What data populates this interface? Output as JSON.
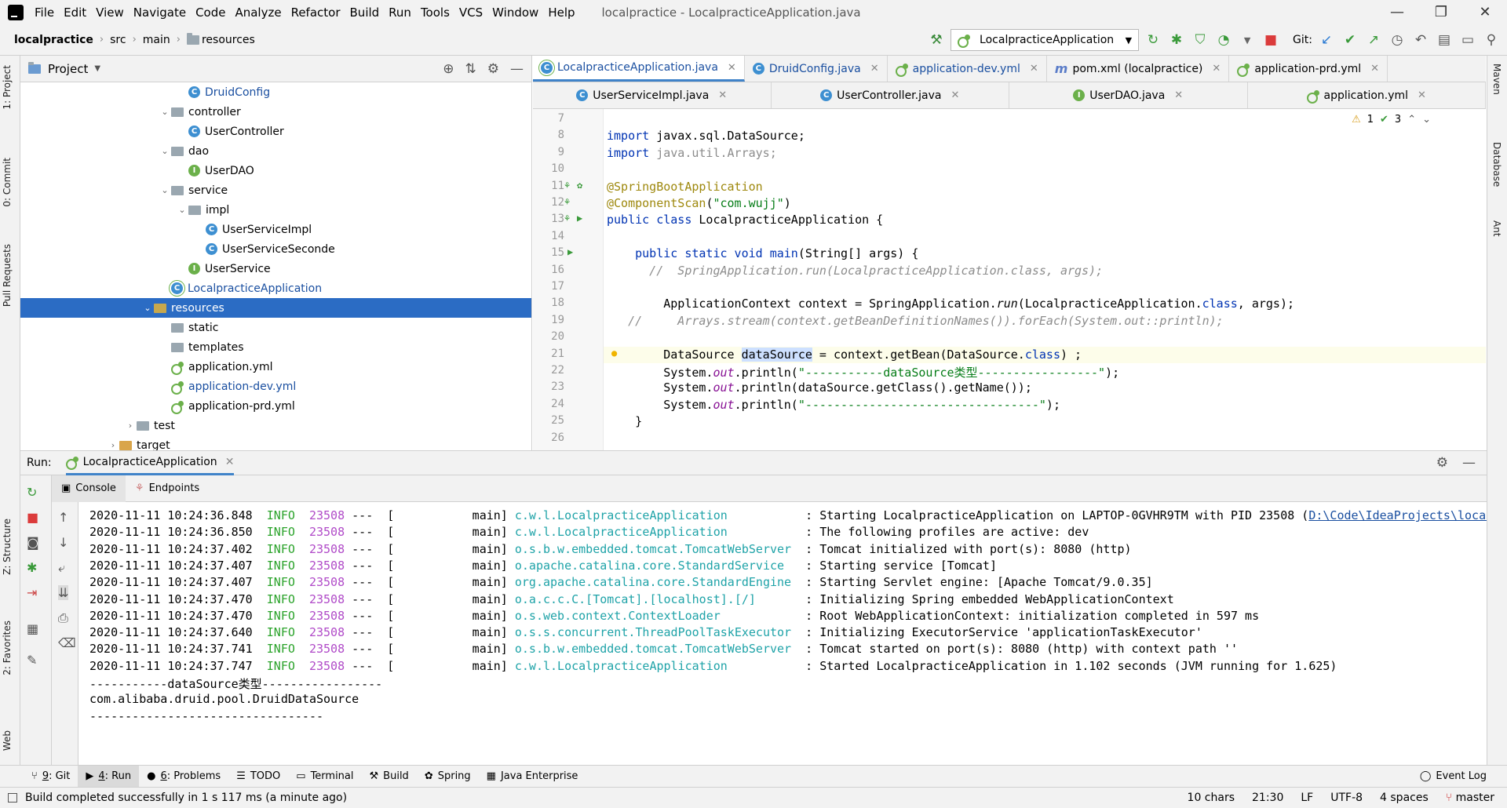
{
  "menubar": {
    "items": [
      "File",
      "Edit",
      "View",
      "Navigate",
      "Code",
      "Analyze",
      "Refactor",
      "Build",
      "Run",
      "Tools",
      "VCS",
      "Window",
      "Help"
    ],
    "window_title": "localpractice - LocalpracticeApplication.java"
  },
  "navbar": {
    "crumbs": [
      "localpractice",
      "src",
      "main",
      "resources"
    ],
    "run_config": "LocalpracticeApplication",
    "git_label": "Git:"
  },
  "left_strip": [
    "1: Project",
    "0: Commit",
    "Pull Requests",
    "Z: Structure",
    "2: Favorites",
    "Web"
  ],
  "right_strip": [
    "Maven",
    "Database",
    "Ant"
  ],
  "project": {
    "title": "Project",
    "tree": [
      {
        "label": "DruidConfig",
        "icon": "class",
        "indent": 2,
        "link": true
      },
      {
        "label": "controller",
        "icon": "folder",
        "indent": 1,
        "arrow": "down"
      },
      {
        "label": "UserController",
        "icon": "class",
        "indent": 2
      },
      {
        "label": "dao",
        "icon": "folder",
        "indent": 1,
        "arrow": "down"
      },
      {
        "label": "UserDAO",
        "icon": "interface",
        "indent": 2
      },
      {
        "label": "service",
        "icon": "folder",
        "indent": 1,
        "arrow": "down"
      },
      {
        "label": "impl",
        "icon": "folder",
        "indent": 2,
        "arrow": "down"
      },
      {
        "label": "UserServiceImpl",
        "icon": "class",
        "indent": 3
      },
      {
        "label": "UserServiceSeconde",
        "icon": "class",
        "indent": 3
      },
      {
        "label": "UserService",
        "icon": "interface",
        "indent": 2
      },
      {
        "label": "LocalpracticeApplication",
        "icon": "springclass",
        "indent": 1,
        "link": true
      },
      {
        "label": "resources",
        "icon": "resfolder",
        "indent": 0,
        "arrow": "down",
        "selected": true
      },
      {
        "label": "static",
        "icon": "folder",
        "indent": 1
      },
      {
        "label": "templates",
        "icon": "folder",
        "indent": 1
      },
      {
        "label": "application.yml",
        "icon": "yml",
        "indent": 1
      },
      {
        "label": "application-dev.yml",
        "icon": "yml",
        "indent": 1,
        "link": true
      },
      {
        "label": "application-prd.yml",
        "icon": "yml",
        "indent": 1
      },
      {
        "label": "test",
        "icon": "testfolder",
        "indent": -1,
        "arrow": "right"
      },
      {
        "label": "target",
        "icon": "targetfolder",
        "indent": -2,
        "arrow": "right"
      }
    ]
  },
  "editor": {
    "tabs_row1": [
      {
        "label": "LocalpracticeApplication.java",
        "icon": "springclass",
        "active": true,
        "blue": true
      },
      {
        "label": "DruidConfig.java",
        "icon": "class",
        "blue": true
      },
      {
        "label": "application-dev.yml",
        "icon": "yml",
        "blue": true
      },
      {
        "label": "pom.xml (localpractice)",
        "icon": "maven"
      },
      {
        "label": "application-prd.yml",
        "icon": "yml"
      }
    ],
    "tabs_row2": [
      {
        "label": "UserServiceImpl.java",
        "icon": "class"
      },
      {
        "label": "UserController.java",
        "icon": "class"
      },
      {
        "label": "UserDAO.java",
        "icon": "interface"
      },
      {
        "label": "application.yml",
        "icon": "yml"
      }
    ],
    "inspections": {
      "warnings": "1",
      "ok": "3"
    },
    "lines": [
      {
        "n": "7",
        "segs": []
      },
      {
        "n": "8",
        "segs": [
          {
            "t": "import ",
            "c": "kw"
          },
          {
            "t": "javax.sql.DataSource;"
          }
        ]
      },
      {
        "n": "9",
        "segs": [
          {
            "t": "import ",
            "c": "kw"
          },
          {
            "t": "java.util.Arrays;",
            "c": "cmt0"
          }
        ]
      },
      {
        "n": "10",
        "segs": []
      },
      {
        "n": "11",
        "segs": [
          {
            "t": "@SpringBootApplication",
            "c": "ann"
          }
        ]
      },
      {
        "n": "12",
        "segs": [
          {
            "t": "@ComponentScan",
            "c": "ann"
          },
          {
            "t": "("
          },
          {
            "t": "\"com.wujj\"",
            "c": "str"
          },
          {
            "t": ")"
          }
        ]
      },
      {
        "n": "13",
        "segs": [
          {
            "t": "public class ",
            "c": "kw"
          },
          {
            "t": "LocalpracticeApplication {"
          }
        ]
      },
      {
        "n": "14",
        "segs": []
      },
      {
        "n": "15",
        "segs": [
          {
            "t": "    public static void ",
            "c": "kw"
          },
          {
            "t": "main",
            "c": "kw"
          },
          {
            "t": "(String[] args) {"
          }
        ]
      },
      {
        "n": "16",
        "segs": [
          {
            "t": "      //  SpringApplication.run(LocalpracticeApplication.class, args);",
            "c": "cmt"
          }
        ]
      },
      {
        "n": "17",
        "segs": []
      },
      {
        "n": "18",
        "segs": [
          {
            "t": "        ApplicationContext context = SpringApplication."
          },
          {
            "t": "run",
            "c": "italic"
          },
          {
            "t": "(LocalpracticeApplication."
          },
          {
            "t": "class",
            "c": "kw"
          },
          {
            "t": ", args);"
          }
        ]
      },
      {
        "n": "19",
        "segs": [
          {
            "t": "   //     Arrays.stream(context.getBeanDefinitionNames()).forEach(System.out::println);",
            "c": "cmt"
          }
        ]
      },
      {
        "n": "20",
        "segs": []
      },
      {
        "n": "21",
        "segs": [
          {
            "t": "        DataSource "
          },
          {
            "t": "dataSource",
            "c": "hlw"
          },
          {
            "t": " = context.getBean(DataSource."
          },
          {
            "t": "class",
            "c": "kw"
          },
          {
            "t": ") ;"
          }
        ],
        "current": true
      },
      {
        "n": "22",
        "segs": [
          {
            "t": "        System."
          },
          {
            "t": "out",
            "c": "fld"
          },
          {
            "t": ".println("
          },
          {
            "t": "\"-----------dataSource类型-----------------\"",
            "c": "str"
          },
          {
            "t": ");"
          }
        ]
      },
      {
        "n": "23",
        "segs": [
          {
            "t": "        System."
          },
          {
            "t": "out",
            "c": "fld"
          },
          {
            "t": ".println(dataSource.getClass().getName());"
          }
        ]
      },
      {
        "n": "24",
        "segs": [
          {
            "t": "        System."
          },
          {
            "t": "out",
            "c": "fld"
          },
          {
            "t": ".println("
          },
          {
            "t": "\"---------------------------------\"",
            "c": "str"
          },
          {
            "t": ");"
          }
        ]
      },
      {
        "n": "25",
        "segs": [
          {
            "t": "    }"
          }
        ]
      },
      {
        "n": "26",
        "segs": []
      }
    ]
  },
  "run": {
    "label": "Run:",
    "tab": "LocalpracticeApplication",
    "subtabs": [
      "Console",
      "Endpoints"
    ],
    "log": [
      {
        "ts": "2020-11-11 10:24:36.848",
        "lvl": "INFO",
        "pid": "23508",
        "thr": "---  [           main]",
        "cls": "c.w.l.LocalpracticeApplication          ",
        "msg": ": Starting LocalpracticeApplication on LAPTOP-0GVHR9TM with PID 23508 (",
        "link": "D:\\Code\\IdeaProjects\\localpr"
      },
      {
        "ts": "2020-11-11 10:24:36.850",
        "lvl": "INFO",
        "pid": "23508",
        "thr": "---  [           main]",
        "cls": "c.w.l.LocalpracticeApplication          ",
        "msg": ": The following profiles are active: dev"
      },
      {
        "ts": "2020-11-11 10:24:37.402",
        "lvl": "INFO",
        "pid": "23508",
        "thr": "---  [           main]",
        "cls": "o.s.b.w.embedded.tomcat.TomcatWebServer ",
        "msg": ": Tomcat initialized with port(s): 8080 (http)"
      },
      {
        "ts": "2020-11-11 10:24:37.407",
        "lvl": "INFO",
        "pid": "23508",
        "thr": "---  [           main]",
        "cls": "o.apache.catalina.core.StandardService  ",
        "msg": ": Starting service [Tomcat]"
      },
      {
        "ts": "2020-11-11 10:24:37.407",
        "lvl": "INFO",
        "pid": "23508",
        "thr": "---  [           main]",
        "cls": "org.apache.catalina.core.StandardEngine ",
        "msg": ": Starting Servlet engine: [Apache Tomcat/9.0.35]"
      },
      {
        "ts": "2020-11-11 10:24:37.470",
        "lvl": "INFO",
        "pid": "23508",
        "thr": "---  [           main]",
        "cls": "o.a.c.c.C.[Tomcat].[localhost].[/]      ",
        "msg": ": Initializing Spring embedded WebApplicationContext"
      },
      {
        "ts": "2020-11-11 10:24:37.470",
        "lvl": "INFO",
        "pid": "23508",
        "thr": "---  [           main]",
        "cls": "o.s.web.context.ContextLoader           ",
        "msg": ": Root WebApplicationContext: initialization completed in 597 ms"
      },
      {
        "ts": "2020-11-11 10:24:37.640",
        "lvl": "INFO",
        "pid": "23508",
        "thr": "---  [           main]",
        "cls": "o.s.s.concurrent.ThreadPoolTaskExecutor ",
        "msg": ": Initializing ExecutorService 'applicationTaskExecutor'"
      },
      {
        "ts": "2020-11-11 10:24:37.741",
        "lvl": "INFO",
        "pid": "23508",
        "thr": "---  [           main]",
        "cls": "o.s.b.w.embedded.tomcat.TomcatWebServer ",
        "msg": ": Tomcat started on port(s): 8080 (http) with context path ''"
      },
      {
        "ts": "2020-11-11 10:24:37.747",
        "lvl": "INFO",
        "pid": "23508",
        "thr": "---  [           main]",
        "cls": "c.w.l.LocalpracticeApplication          ",
        "msg": ": Started LocalpracticeApplication in 1.102 seconds (JVM running for 1.625)"
      }
    ],
    "plain": [
      "-----------dataSource类型-----------------",
      "com.alibaba.druid.pool.DruidDataSource",
      "---------------------------------"
    ]
  },
  "bottom_tools": [
    {
      "num": "9",
      "label": ": Git",
      "icon": "git-icon"
    },
    {
      "num": "4",
      "label": ": Run",
      "icon": "run-icon",
      "active": true
    },
    {
      "num": "6",
      "label": ": Problems",
      "icon": "problems-icon"
    },
    {
      "num": "",
      "label": "TODO",
      "icon": "todo-icon"
    },
    {
      "num": "",
      "label": "Terminal",
      "icon": "terminal-icon"
    },
    {
      "num": "",
      "label": "Build",
      "icon": "build-icon"
    },
    {
      "num": "",
      "label": "Spring",
      "icon": "spring-icon"
    },
    {
      "num": "",
      "label": "Java Enterprise",
      "icon": "java-enterprise-icon"
    }
  ],
  "event_log": "Event Log",
  "status": {
    "message": "Build completed successfully in 1 s 117 ms (a minute ago)",
    "chars": "10 chars",
    "pos": "21:30",
    "lf": "LF",
    "enc": "UTF-8",
    "indent": "4 spaces",
    "branch": "master"
  }
}
